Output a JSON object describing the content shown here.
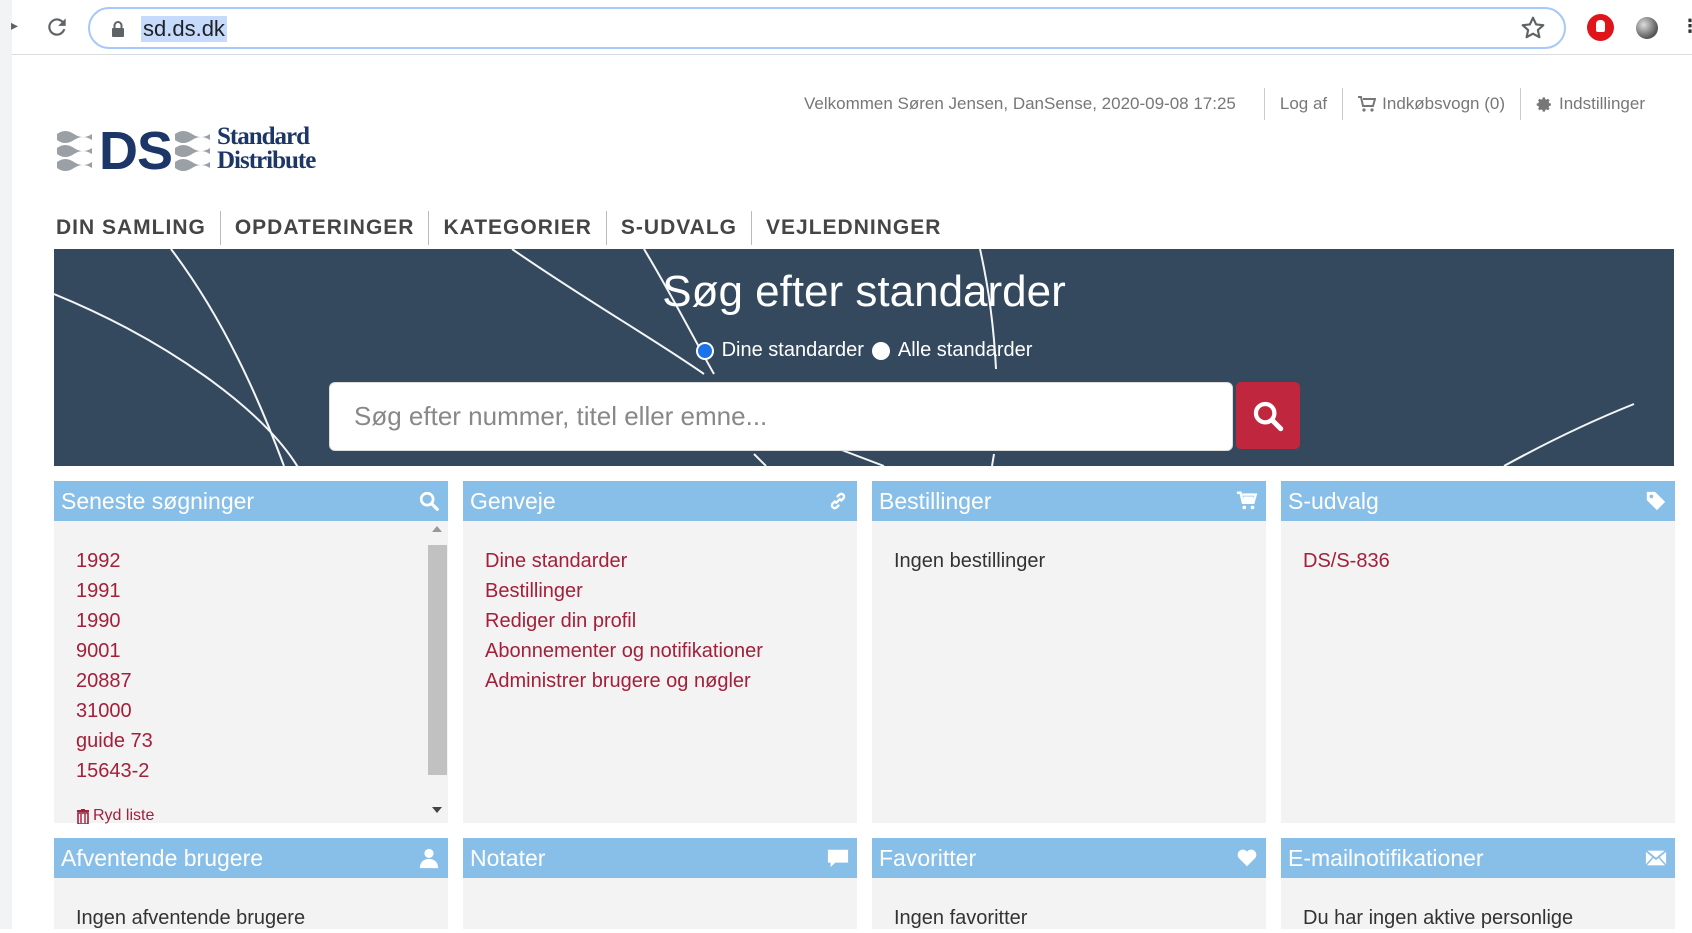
{
  "browser": {
    "url": "sd.ds.dk"
  },
  "header": {
    "welcome": "Velkommen Søren Jensen, DanSense, 2020-09-08 17:25",
    "logout": "Log af",
    "cart": "Indkøbsvogn (0)",
    "settings": "Indstillinger"
  },
  "logo": {
    "mark": "DS",
    "line1": "Standard",
    "line2": "Distribute"
  },
  "nav": {
    "items": [
      "DIN SAMLING",
      "OPDATERINGER",
      "KATEGORIER",
      "S-UDVALG",
      "VEJLEDNINGER"
    ]
  },
  "hero": {
    "title": "Søg efter standarder",
    "radio_own": "Dine standarder",
    "radio_all": "Alle standarder",
    "selected": "Dine standarder",
    "search_placeholder": "Søg efter nummer, titel eller emne..."
  },
  "panels": {
    "recent": {
      "title": "Seneste søgninger",
      "items": [
        "1992",
        "1991",
        "1990",
        "9001",
        "20887",
        "31000",
        "guide 73",
        "15643-2"
      ],
      "clear": "Ryd liste"
    },
    "shortcuts": {
      "title": "Genveje",
      "items": [
        "Dine standarder",
        "Bestillinger",
        "Rediger din profil",
        "Abonnementer og notifikationer",
        "Administrer brugere og nøgler"
      ]
    },
    "orders": {
      "title": "Bestillinger",
      "empty": "Ingen bestillinger"
    },
    "sselection": {
      "title": "S-udvalg",
      "items": [
        "DS/S-836"
      ]
    },
    "pending": {
      "title": "Afventende brugere",
      "empty": "Ingen afventende brugere"
    },
    "notes": {
      "title": "Notater"
    },
    "favorites": {
      "title": "Favoritter",
      "empty": "Ingen favoritter"
    },
    "email": {
      "title": "E-mailnotifikationer",
      "empty": "Du har ingen aktive personlige"
    }
  },
  "colors": {
    "hero_bg": "#34495e",
    "panel_head": "#88bfe8",
    "link": "#a3203a",
    "search_button": "#c0273f",
    "logo": "#1d3668"
  }
}
